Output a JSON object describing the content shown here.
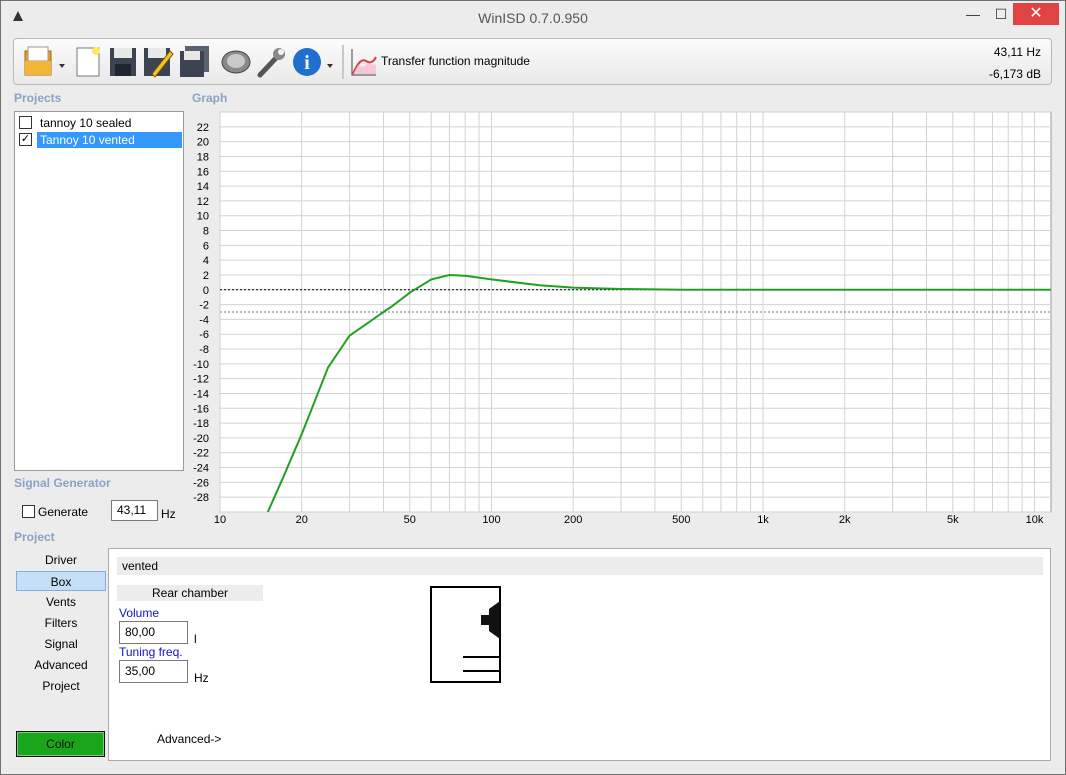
{
  "window": {
    "title": "WinISD 0.7.0.950",
    "min_glyph": "—",
    "max_glyph": "☐",
    "close_glyph": "✕"
  },
  "toolbar": {
    "icons": [
      "open-icon",
      "new-icon",
      "save-icon",
      "save-as-icon",
      "save-all-icon",
      "speaker-icon",
      "wrench-icon",
      "info-icon",
      "transfer-function-icon"
    ],
    "graph_mode": "Transfer function magnitude",
    "cursor_hz": "43,11 Hz",
    "cursor_db": "-6,173 dB"
  },
  "projects": {
    "label": "Projects",
    "items": [
      {
        "name": "tannoy 10 sealed",
        "checked": false,
        "selected": false
      },
      {
        "name": "Tannoy 10 vented",
        "checked": true,
        "selected": true
      }
    ]
  },
  "graph": {
    "label": "Graph"
  },
  "signal_generator": {
    "label": "Signal Generator",
    "generate_label": "Generate",
    "frequency": "43,11",
    "unit": "Hz"
  },
  "project_nav": {
    "label": "Project",
    "items": [
      "Driver",
      "Box",
      "Vents",
      "Filters",
      "Signal",
      "Advanced",
      "Project"
    ],
    "selected": "Box",
    "color_button": "Color"
  },
  "box": {
    "type": "vented",
    "rear_chamber": "Rear chamber",
    "volume_label": "Volume",
    "volume_value": "80,00",
    "volume_unit": "l",
    "tuning_label": "Tuning freq.",
    "tuning_value": "35,00",
    "tuning_unit": "Hz",
    "advanced_link": "Advanced->"
  },
  "chart_data": {
    "type": "line",
    "title": "",
    "xlabel": "",
    "ylabel": "",
    "x_scale": "log",
    "xlim": [
      10,
      11500
    ],
    "ylim": [
      -30,
      24
    ],
    "x_ticks": [
      10,
      20,
      50,
      100,
      200,
      500,
      1000,
      2000,
      5000,
      10000
    ],
    "x_tick_labels": [
      "10",
      "20",
      "50",
      "100",
      "200",
      "500",
      "1k",
      "2k",
      "5k",
      "10k"
    ],
    "y_ticks": [
      22,
      20,
      18,
      16,
      14,
      12,
      10,
      8,
      6,
      4,
      2,
      0,
      -2,
      -4,
      -6,
      -8,
      -10,
      -12,
      -14,
      -16,
      -18,
      -20,
      -22,
      -24,
      -26,
      -28
    ],
    "grid": true,
    "reference_lines": [
      {
        "y": 0,
        "style": "dotted",
        "color": "#000000"
      },
      {
        "y": -3,
        "style": "dotted",
        "color": "#777777"
      }
    ],
    "series": [
      {
        "color": "#22a022",
        "x": [
          15,
          17,
          20,
          25,
          30,
          35,
          40,
          43.11,
          50,
          60,
          70,
          80,
          100,
          150,
          200,
          300,
          400,
          500,
          1000,
          2000,
          5000,
          10000,
          11500
        ],
        "y": [
          -30,
          -25.5,
          -19.5,
          -10.5,
          -6.2,
          -4.5,
          -3,
          -2.2,
          -0.4,
          1.4,
          2,
          1.9,
          1.4,
          0.6,
          0.3,
          0.1,
          0.05,
          0,
          0,
          0,
          0,
          0,
          0
        ]
      }
    ]
  }
}
